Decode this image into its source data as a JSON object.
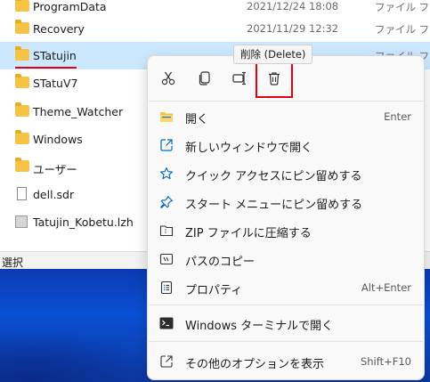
{
  "explorer": {
    "files": [
      {
        "name": "ProgramData",
        "date": "2021/12/24 18:08",
        "type": "ファイル フォル",
        "icon": "folder-icon",
        "selected": false
      },
      {
        "name": "Recovery",
        "date": "2021/11/29 12:32",
        "type": "ファイル フォル",
        "icon": "folder-icon",
        "selected": false
      },
      {
        "name": "STatujin",
        "date": "",
        "type": "ファイル フォル",
        "icon": "folder-icon",
        "selected": true
      },
      {
        "name": "STatuV7",
        "date": "",
        "type": "",
        "icon": "folder-icon",
        "selected": false
      },
      {
        "name": "Theme_Watcher",
        "date": "",
        "type": "",
        "icon": "folder-icon",
        "selected": false
      },
      {
        "name": "Windows",
        "date": "",
        "type": "",
        "icon": "folder-icon",
        "selected": false
      },
      {
        "name": "ユーザー",
        "date": "",
        "type": "",
        "icon": "folder-icon",
        "selected": false
      },
      {
        "name": "dell.sdr",
        "date": "",
        "type": "",
        "icon": "doc-icon",
        "selected": false
      },
      {
        "name": "Tatujin_Kobetu.lzh",
        "date": "",
        "type": "",
        "icon": "app-icon",
        "selected": false
      }
    ],
    "status_text": "選択"
  },
  "tooltip": "削除 (Delete)",
  "context_menu": {
    "toolbar": [
      {
        "name": "cut-icon"
      },
      {
        "name": "copy-icon"
      },
      {
        "name": "rename-icon"
      },
      {
        "name": "delete-icon"
      }
    ],
    "items": [
      {
        "label": "開く",
        "shortcut": "Enter",
        "icon": "open-folder-icon"
      },
      {
        "label": "新しいウィンドウで開く",
        "shortcut": "",
        "icon": "new-window-icon"
      },
      {
        "label": "クイック アクセスにピン留めする",
        "shortcut": "",
        "icon": "star-icon"
      },
      {
        "label": "スタート メニューにピン留めする",
        "shortcut": "",
        "icon": "pin-icon"
      },
      {
        "label": "ZIP ファイルに圧縮する",
        "shortcut": "",
        "icon": "zip-icon"
      },
      {
        "label": "パスのコピー",
        "shortcut": "",
        "icon": "path-copy-icon"
      },
      {
        "label": "プロパティ",
        "shortcut": "Alt+Enter",
        "icon": "properties-icon"
      }
    ],
    "terminal_item": {
      "label": "Windows ターミナルで開く",
      "shortcut": "",
      "icon": "terminal-icon"
    },
    "more_item": {
      "label": "その他のオプションを表示",
      "shortcut": "Shift+F10",
      "icon": "more-options-icon"
    }
  },
  "colors": {
    "accent": "#0067c0",
    "highlight": "#e0000f",
    "selection": "#cce8ff"
  }
}
